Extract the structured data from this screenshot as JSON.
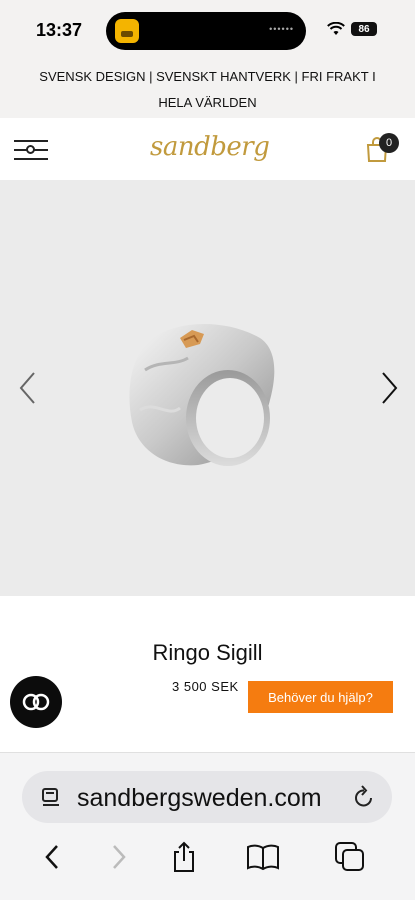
{
  "status_bar": {
    "time": "13:37",
    "battery": "86"
  },
  "announcement": {
    "text": "SVENSK DESIGN | SVENSKT HANTVERK | FRI FRAKT I HELA VÄRLDEN"
  },
  "header": {
    "logo": "sandberg",
    "cart_count": "0"
  },
  "product": {
    "title": "Ringo Sigill",
    "price": "3 500 SEK"
  },
  "help_button": {
    "label": "Behöver du hjälp?"
  },
  "browser": {
    "url": "sandbergsweden.com"
  },
  "colors": {
    "accent": "#f57c10",
    "logo_gold": "#c19a3d",
    "background": "#ebebeb"
  }
}
